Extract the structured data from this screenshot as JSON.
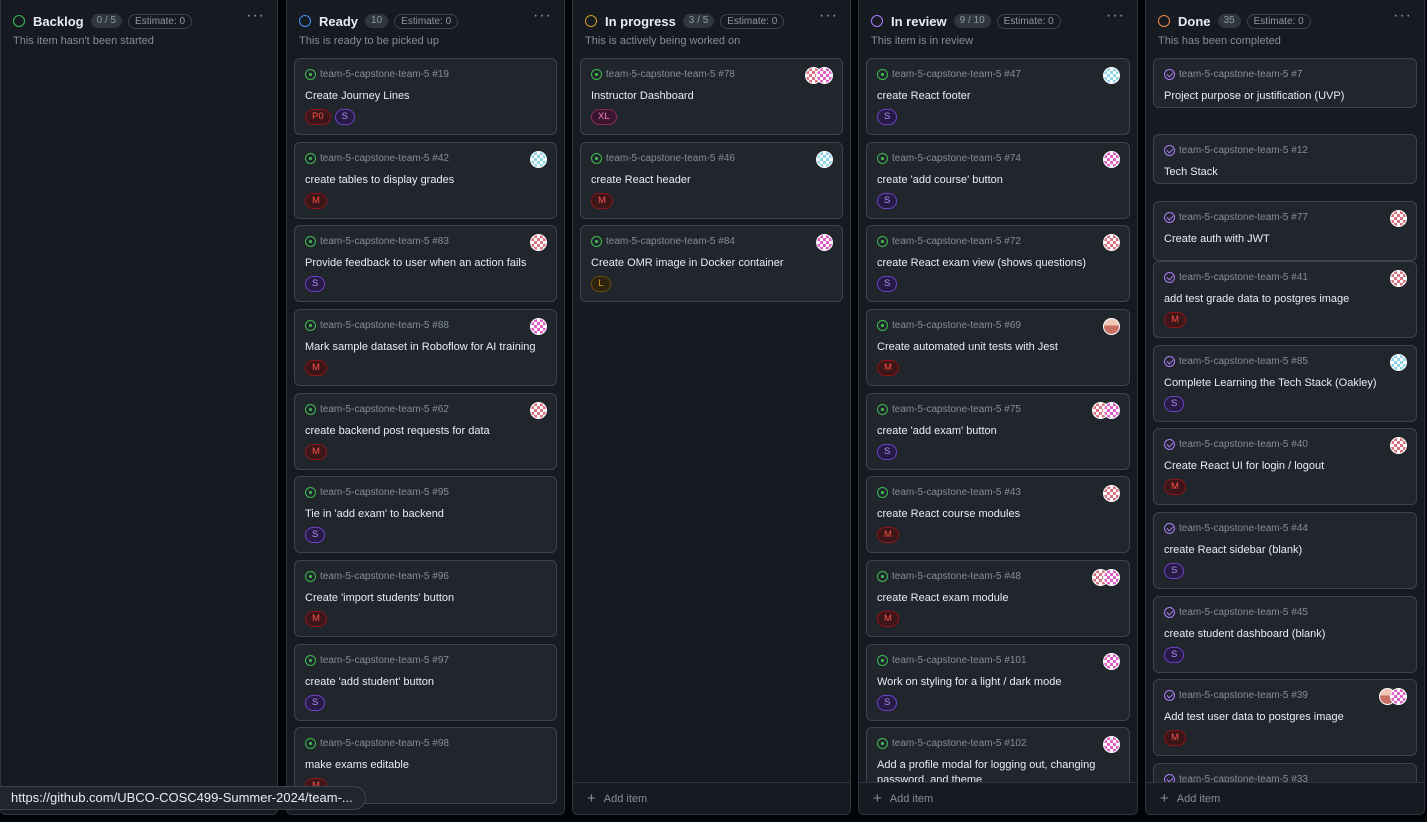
{
  "columns": [
    {
      "title": "Backlog",
      "count": "0 / 5",
      "estimate": "Estimate: 0",
      "description": "This item hasn't been started",
      "dot_color": "#3fb950",
      "more": "···",
      "add_item": "",
      "cards": []
    },
    {
      "title": "Ready",
      "count": "10",
      "estimate": "Estimate: 0",
      "description": "This is ready to be picked up",
      "dot_color": "#4493f8",
      "more": "···",
      "add_item": "",
      "cards": [
        {
          "repo": "team-5-capstone-team-5 #19",
          "title": "Create Journey Lines",
          "labels": [
            "P0",
            "S"
          ],
          "avatars": [],
          "done": false
        },
        {
          "repo": "team-5-capstone-team-5 #42",
          "title": "create tables to display grades",
          "labels": [
            "M"
          ],
          "avatars": [
            "teal"
          ],
          "done": false
        },
        {
          "repo": "team-5-capstone-team-5 #83",
          "title": "Provide feedback to user when an action fails",
          "labels": [
            "S"
          ],
          "avatars": [
            "red"
          ],
          "done": false
        },
        {
          "repo": "team-5-capstone-team-5 #88",
          "title": "Mark sample dataset in Roboflow for AI training",
          "labels": [
            "M"
          ],
          "avatars": [
            "pink"
          ],
          "done": false
        },
        {
          "repo": "team-5-capstone-team-5 #62",
          "title": "create backend post requests for data",
          "labels": [
            "M"
          ],
          "avatars": [
            "red"
          ],
          "done": false
        },
        {
          "repo": "team-5-capstone-team-5 #95",
          "title": "Tie in 'add exam' to backend",
          "labels": [
            "S"
          ],
          "avatars": [],
          "done": false
        },
        {
          "repo": "team-5-capstone-team-5 #96",
          "title": "Create 'import students' button",
          "labels": [
            "M"
          ],
          "avatars": [],
          "done": false
        },
        {
          "repo": "team-5-capstone-team-5 #97",
          "title": "create 'add student' button",
          "labels": [
            "S"
          ],
          "avatars": [],
          "done": false
        },
        {
          "repo": "team-5-capstone-team-5 #98",
          "title": "make exams editable",
          "labels": [
            "M"
          ],
          "avatars": [],
          "done": false
        }
      ]
    },
    {
      "title": "In progress",
      "count": "3 / 5",
      "estimate": "Estimate: 0",
      "description": "This is actively being worked on",
      "dot_color": "#d29922",
      "more": "···",
      "add_item": "Add item",
      "cards": [
        {
          "repo": "team-5-capstone-team-5 #78",
          "title": "Instructor Dashboard",
          "labels": [
            "XL"
          ],
          "avatars": [
            "pink",
            "red"
          ],
          "done": false
        },
        {
          "repo": "team-5-capstone-team-5 #46",
          "title": "create React header",
          "labels": [
            "M"
          ],
          "avatars": [
            "teal"
          ],
          "done": false
        },
        {
          "repo": "team-5-capstone-team-5 #84",
          "title": "Create OMR image in Docker container",
          "labels": [
            "L"
          ],
          "avatars": [
            "pink"
          ],
          "done": false
        }
      ]
    },
    {
      "title": "In review",
      "count": "9 / 10",
      "estimate": "Estimate: 0",
      "description": "This item is in review",
      "dot_color": "#ab7df8",
      "more": "···",
      "add_item": "Add item",
      "cards": [
        {
          "repo": "team-5-capstone-team-5 #47",
          "title": "create React footer",
          "labels": [
            "S"
          ],
          "avatars": [
            "teal"
          ],
          "done": false
        },
        {
          "repo": "team-5-capstone-team-5 #74",
          "title": "create 'add course' button",
          "labels": [
            "S"
          ],
          "avatars": [
            "pink"
          ],
          "done": false
        },
        {
          "repo": "team-5-capstone-team-5 #72",
          "title": "create React exam view (shows questions)",
          "labels": [
            "S"
          ],
          "avatars": [
            "red"
          ],
          "done": false
        },
        {
          "repo": "team-5-capstone-team-5 #69",
          "title": "Create automated unit tests with Jest",
          "labels": [
            "M"
          ],
          "avatars": [
            "peach"
          ],
          "done": false
        },
        {
          "repo": "team-5-capstone-team-5 #75",
          "title": "create 'add exam' button",
          "labels": [
            "S"
          ],
          "avatars": [
            "pink",
            "red"
          ],
          "done": false
        },
        {
          "repo": "team-5-capstone-team-5 #43",
          "title": "create React course modules",
          "labels": [
            "M"
          ],
          "avatars": [
            "red"
          ],
          "done": false
        },
        {
          "repo": "team-5-capstone-team-5 #48",
          "title": "create React exam module",
          "labels": [
            "M"
          ],
          "avatars": [
            "pink",
            "red"
          ],
          "done": false
        },
        {
          "repo": "team-5-capstone-team-5 #101",
          "title": "Work on styling for a light / dark mode",
          "labels": [
            "S"
          ],
          "avatars": [
            "pink"
          ],
          "done": false
        },
        {
          "repo": "team-5-capstone-team-5 #102",
          "title": "Add a profile modal for logging out, changing password, and theme",
          "labels": [],
          "avatars": [
            "pink"
          ],
          "done": false
        }
      ]
    },
    {
      "title": "Done",
      "count": "35",
      "estimate": "Estimate: 0",
      "description": "This has been completed",
      "dot_color": "#f0883e",
      "more": "···",
      "add_item": "Add item",
      "cards": [
        {
          "repo": "team-5-capstone-team-5 #7",
          "title": "Project purpose or justification (UVP)",
          "labels": [],
          "avatars": [],
          "done": true
        },
        {
          "repo": "team-5-capstone-team-5 #12",
          "title": "Tech Stack",
          "labels": [],
          "avatars": [],
          "done": true
        },
        {
          "repo": "team-5-capstone-team-5 #77",
          "title": "Create auth with JWT",
          "labels": [],
          "avatars": [
            "red"
          ],
          "done": true
        },
        {
          "repo": "team-5-capstone-team-5 #41",
          "title": "add test grade data to postgres image",
          "labels": [
            "M"
          ],
          "avatars": [
            "red"
          ],
          "done": true
        },
        {
          "repo": "team-5-capstone-team-5 #85",
          "title": "Complete Learning the Tech Stack (Oakley)",
          "labels": [
            "S"
          ],
          "avatars": [
            "teal"
          ],
          "done": true
        },
        {
          "repo": "team-5-capstone-team-5 #40",
          "title": "Create React UI for login / logout",
          "labels": [
            "M"
          ],
          "avatars": [
            "red"
          ],
          "done": true
        },
        {
          "repo": "team-5-capstone-team-5 #44",
          "title": "create React sidebar (blank)",
          "labels": [
            "S"
          ],
          "avatars": [],
          "done": true
        },
        {
          "repo": "team-5-capstone-team-5 #45",
          "title": "create student dashboard (blank)",
          "labels": [
            "S"
          ],
          "avatars": [],
          "done": true
        },
        {
          "repo": "team-5-capstone-team-5 #39",
          "title": "Add test user data to postgres image",
          "labels": [
            "M"
          ],
          "avatars": [
            "pink",
            "peach"
          ],
          "done": true
        },
        {
          "repo": "team-5-capstone-team-5 #33",
          "title": "",
          "labels": [],
          "avatars": [],
          "done": true
        }
      ]
    }
  ],
  "status_url": "https://github.com/UBCO-COSC499-Summer-2024/team-..."
}
